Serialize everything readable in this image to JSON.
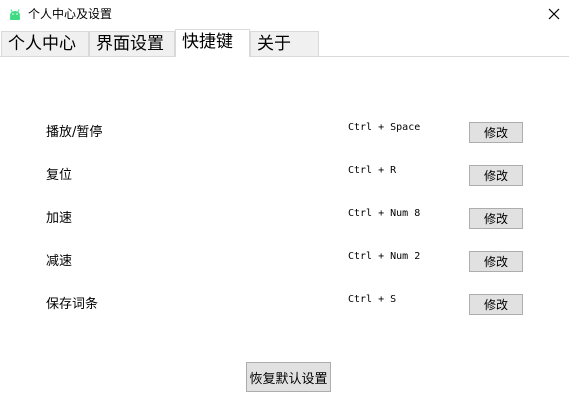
{
  "window": {
    "title": "个人中心及设置",
    "app_icon": "android-icon",
    "close_icon": "close-icon"
  },
  "tabs": [
    {
      "label": "个人中心",
      "active": false
    },
    {
      "label": "界面设置",
      "active": false
    },
    {
      "label": "快捷键",
      "active": true
    },
    {
      "label": "关于",
      "active": false
    }
  ],
  "shortcuts": [
    {
      "action": "播放/暂停",
      "keys": "Ctrl + Space",
      "button": "修改"
    },
    {
      "action": "复位",
      "keys": "Ctrl + R",
      "button": "修改"
    },
    {
      "action": "加速",
      "keys": "Ctrl + Num 8",
      "button": "修改"
    },
    {
      "action": "减速",
      "keys": "Ctrl + Num 2",
      "button": "修改"
    },
    {
      "action": "保存词条",
      "keys": "Ctrl + S",
      "button": "修改"
    }
  ],
  "reset_button": "恢复默认设置",
  "colors": {
    "icon_green": "#3ddc84",
    "button_bg": "#e1e1e1",
    "button_border": "#adadad",
    "tab_bg": "#f0f0f0"
  }
}
